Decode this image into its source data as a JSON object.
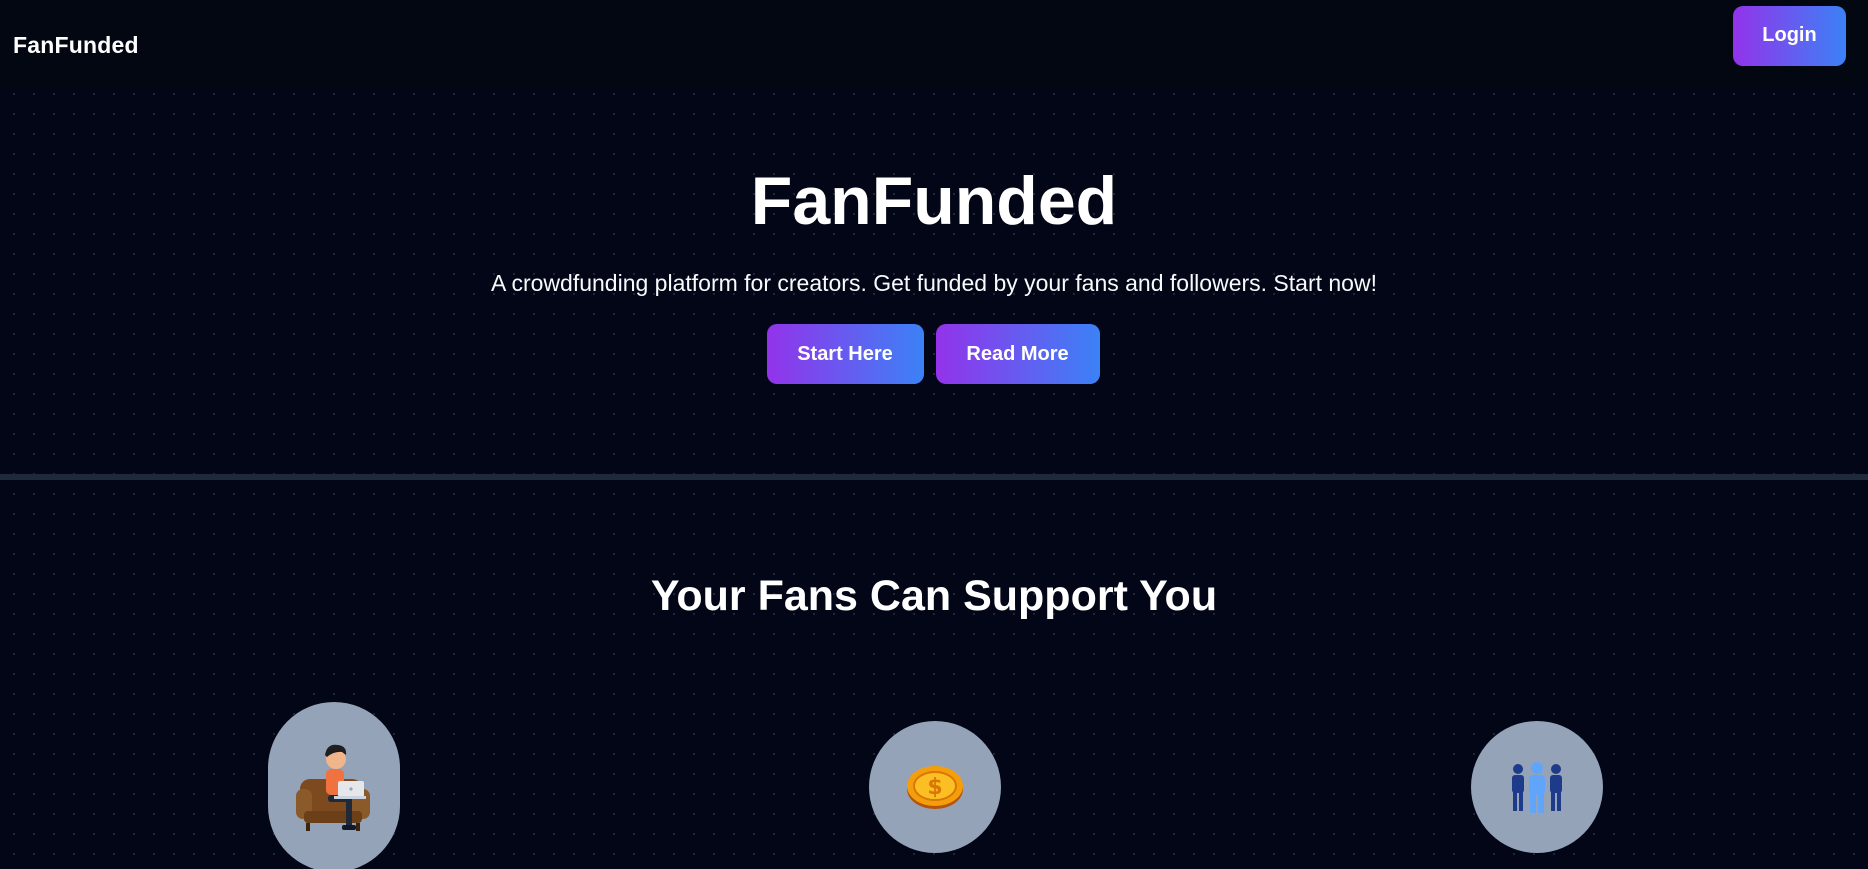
{
  "navbar": {
    "brand": "FanFunded",
    "login_label": "Login"
  },
  "hero": {
    "title": "FanFunded",
    "subtitle": "A crowdfunding platform for creators. Get funded by your fans and followers. Start now!",
    "start_label": "Start Here",
    "read_more_label": "Read More"
  },
  "support": {
    "title": "Your Fans Can Support You",
    "features": [
      {
        "icon": "creator-on-laptop-icon"
      },
      {
        "icon": "gold-coin-icon"
      },
      {
        "icon": "group-of-people-icon"
      }
    ]
  },
  "colors": {
    "background": "#020617",
    "navbar": "#030712",
    "accent_start": "#9333ea",
    "accent_end": "#3b82f6",
    "icon_circle": "#94a3b8"
  }
}
